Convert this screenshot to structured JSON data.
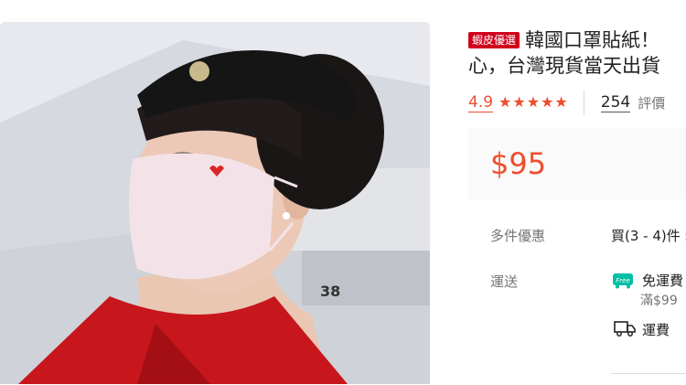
{
  "product": {
    "badge": "蝦皮優選",
    "title_line1": "韓國口罩貼紙！",
    "title_line2": "心，台灣現貨當天出貨"
  },
  "rating": {
    "value": "4.9",
    "stars": 5,
    "review_count": "254",
    "review_label": "評價"
  },
  "price": "$95",
  "details": {
    "bulk_label": "多件優惠",
    "bulk_value": "買(3 - 4)件 $",
    "shipping_label": "運送",
    "free_tag": "Free",
    "free_shipping": "免運費",
    "min_order": "滿$99",
    "shipping_fee": "運費"
  },
  "colors": {
    "accent": "#ee4d2d",
    "badge": "#d0011b",
    "free_tag": "#00bfa5"
  },
  "icons": [
    "star-icon",
    "free-shipping-icon",
    "truck-icon"
  ]
}
